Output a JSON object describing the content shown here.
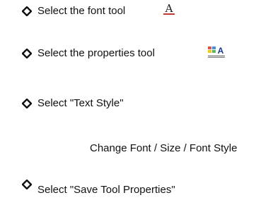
{
  "steps": [
    {
      "text": "Select the font tool",
      "icon": "font-tool-icon"
    },
    {
      "text": "Select the properties tool",
      "icon": "properties-tool-icon"
    },
    {
      "text": "Select \"Text Style\"",
      "icon": ""
    },
    {
      "text": "Select \"Save Tool Properties\"",
      "icon": ""
    }
  ],
  "substep": "Change Font / Size / Font Style",
  "bullet_icon": "diamond-bullet-icon",
  "font_tool_glyph": "A",
  "properties_tool_glyph": "A",
  "colors": {
    "bullet": "#111111",
    "font_tool_underline": "#c0392b",
    "font_tool_letter": "#1a1a1a"
  }
}
